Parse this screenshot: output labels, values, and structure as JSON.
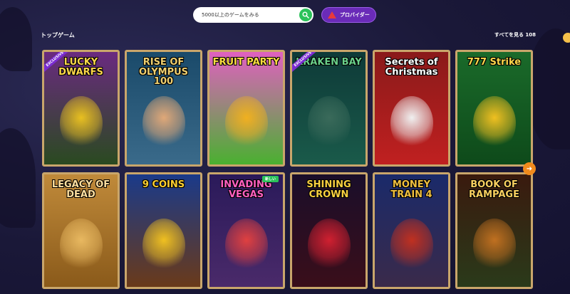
{
  "search": {
    "placeholder": "5000以上のゲームをみる"
  },
  "provider_button": {
    "label": "プロバイダー"
  },
  "section": {
    "title": "トップゲーム",
    "see_all": "すべてを見る 108"
  },
  "badges": {
    "exclusive": "EXCLUSIVE",
    "new": "新しい"
  },
  "games": [
    {
      "title": "LUCKY DWARFS",
      "top": "#6a2a80",
      "bottom": "#2a4a20",
      "accent": "#e8c020",
      "title_color": "#ffd84a"
    },
    {
      "title": "RISE OF OLYMPUS 100",
      "top": "#1a4a6a",
      "bottom": "#3a6a8a",
      "accent": "#e0a878",
      "title_color": "#f0d070"
    },
    {
      "title": "FRUIT PARTY",
      "top": "#e060c0",
      "bottom": "#4ab030",
      "accent": "#f0b020",
      "title_color": "#ffe040"
    },
    {
      "title": "KRAKEN BAY",
      "top": "#0e3a38",
      "bottom": "#1a5a4a",
      "accent": "#3a6a5a",
      "title_color": "#6ad08a"
    },
    {
      "title": "Secrets of Christmas",
      "top": "#8a1a1a",
      "bottom": "#c02020",
      "accent": "#f0f0f0",
      "title_color": "#ffffff"
    },
    {
      "title": "777 Strike",
      "top": "#1a6a2a",
      "bottom": "#0e4a1a",
      "accent": "#f0c020",
      "title_color": "#ffd84a"
    },
    {
      "title": "LEGACY OF DEAD",
      "top": "#c08a3a",
      "bottom": "#8a5a1a",
      "accent": "#e8b860",
      "title_color": "#ffe0a0"
    },
    {
      "title": "9 COINS",
      "top": "#1a3a8a",
      "bottom": "#6a3a1a",
      "accent": "#f0c020",
      "title_color": "#ffd030"
    },
    {
      "title": "INVADING VEGAS",
      "top": "#2a1a5a",
      "bottom": "#4a2a6a",
      "accent": "#e04040",
      "title_color": "#ff60c0"
    },
    {
      "title": "SHINING CROWN",
      "top": "#1a0e2a",
      "bottom": "#3a0e1a",
      "accent": "#d02030",
      "title_color": "#f8d040"
    },
    {
      "title": "MONEY TRAIN 4",
      "top": "#1a2a6a",
      "bottom": "#3a2a4a",
      "accent": "#c03020",
      "title_color": "#f0c040"
    },
    {
      "title": "BOOK OF RAMPAGE",
      "top": "#3a1a0e",
      "bottom": "#2a3a1a",
      "accent": "#c07020",
      "title_color": "#f8d060"
    }
  ]
}
